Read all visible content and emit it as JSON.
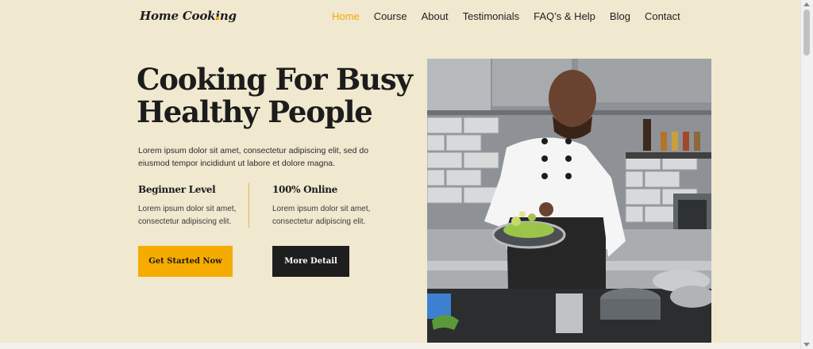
{
  "nav": {
    "logo": "Home Cooking",
    "items": [
      {
        "label": "Home",
        "active": true
      },
      {
        "label": "Course",
        "active": false
      },
      {
        "label": "About",
        "active": false
      },
      {
        "label": "Testimonials",
        "active": false
      },
      {
        "label": "FAQ’s & Help",
        "active": false
      },
      {
        "label": "Blog",
        "active": false
      },
      {
        "label": "Contact",
        "active": false
      }
    ]
  },
  "hero": {
    "title_line1": "Cooking For Busy",
    "title_line2": "Healthy People",
    "description": "Lorem ipsum dolor sit amet, consectetur adipiscing elit, sed do eiusmod tempor incididunt ut labore et dolore magna.",
    "features": [
      {
        "title": "Beginner Level",
        "text": "Lorem ipsum dolor sit amet, consectetur adipiscing elit."
      },
      {
        "title": "100% Online",
        "text": "Lorem ipsum dolor sit amet, consectetur adipiscing elit."
      }
    ],
    "primary_button": "Get Started Now",
    "secondary_button": "More Detail",
    "image_subject": "chef tossing vegetables in a pan"
  },
  "colors": {
    "background": "#f0e8cf",
    "accent": "#f5ab00",
    "dark": "#1e1e1e"
  }
}
